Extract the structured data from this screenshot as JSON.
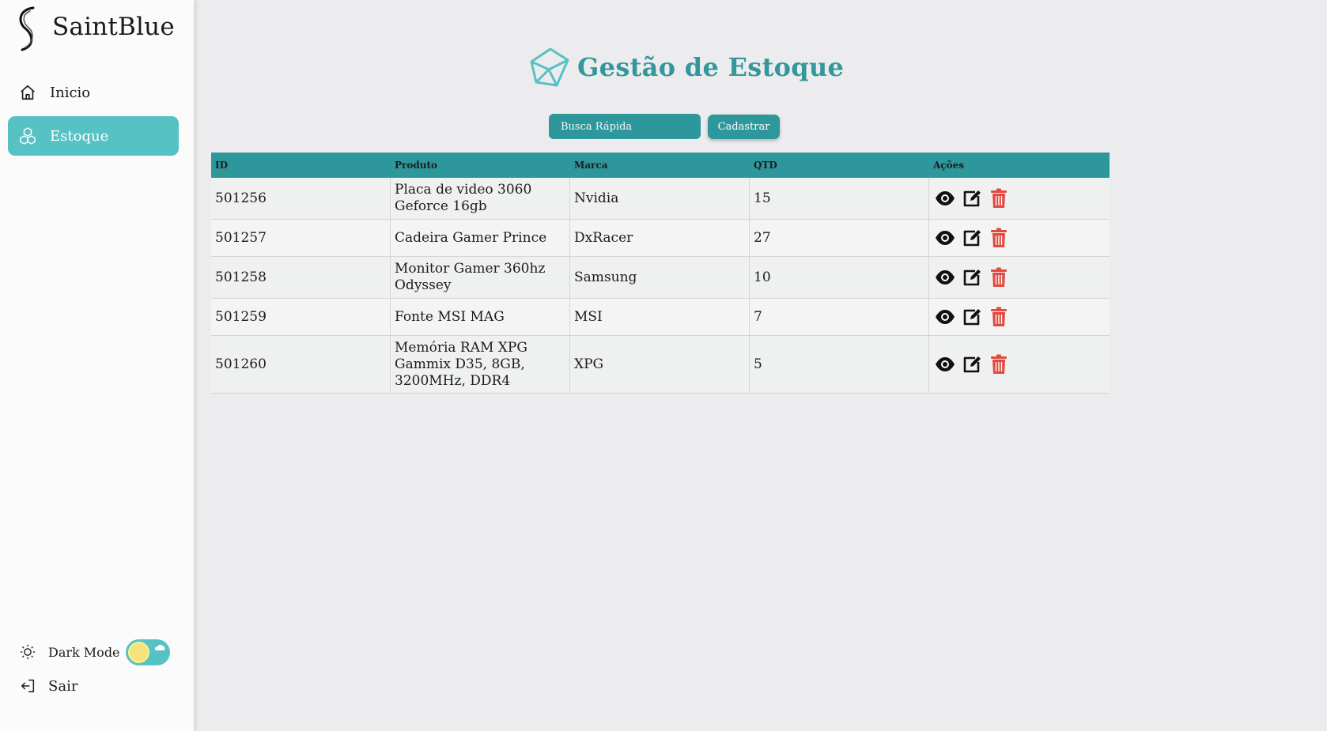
{
  "brand": {
    "name": "SaintBlue"
  },
  "sidebar": {
    "items": [
      {
        "label": "Inicio",
        "icon": "home-icon"
      },
      {
        "label": "Estoque",
        "icon": "cubes-icon",
        "active": true
      }
    ],
    "dark_mode_label": "Dark Mode",
    "logout_label": "Sair"
  },
  "header": {
    "title": "Gestão de Estoque",
    "icon": "cube-icon"
  },
  "toolbar": {
    "search_placeholder": "Busca Rápida",
    "register_label": "Cadastrar"
  },
  "table": {
    "columns": [
      "ID",
      "Produto",
      "Marca",
      "QTD",
      "Ações"
    ],
    "rows": [
      {
        "id": "501256",
        "produto": "Placa de video 3060 Geforce 16gb",
        "marca": "Nvidia",
        "qtd": "15"
      },
      {
        "id": "501257",
        "produto": "Cadeira Gamer Prince",
        "marca": "DxRacer",
        "qtd": "27"
      },
      {
        "id": "501258",
        "produto": "Monitor Gamer 360hz Odyssey",
        "marca": "Samsung",
        "qtd": "10"
      },
      {
        "id": "501259",
        "produto": "Fonte MSI MAG",
        "marca": "MSI",
        "qtd": "7"
      },
      {
        "id": "501260",
        "produto": "Memória RAM XPG Gammix D35, 8GB, 3200MHz, DDR4",
        "marca": "XPG",
        "qtd": "5"
      }
    ]
  },
  "colors": {
    "accent": "#2e979c",
    "active_nav": "#56c2c4",
    "delete": "#e04a3f"
  }
}
